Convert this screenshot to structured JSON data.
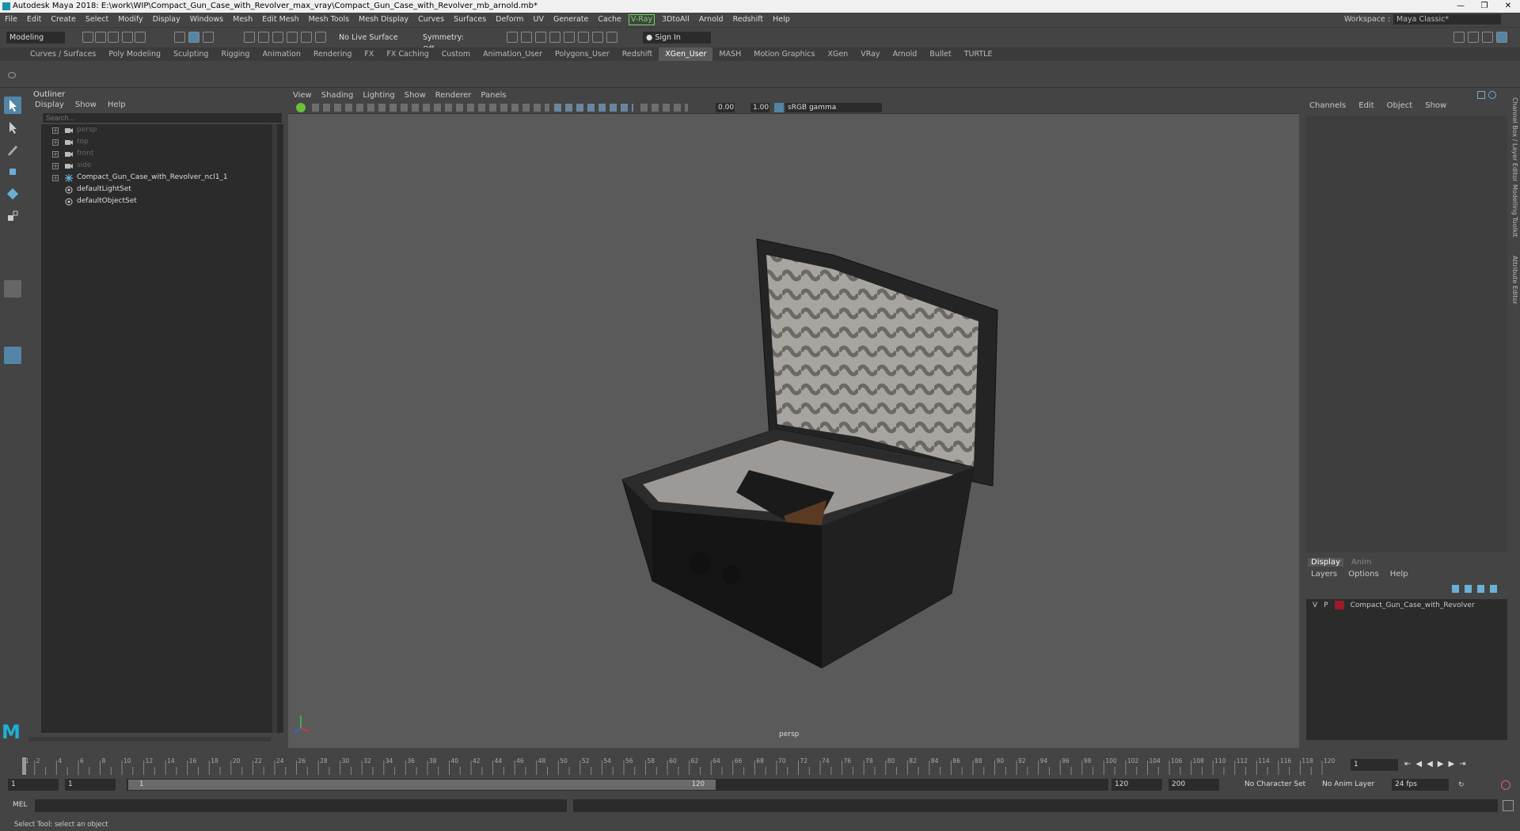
{
  "window": {
    "title": "Autodesk Maya 2018: E:\\work\\WIP\\Compact_Gun_Case_with_Revolver_max_vray\\Compact_Gun_Case_with_Revolver_mb_arnold.mb*",
    "controls": [
      "—",
      "❐",
      "✕"
    ]
  },
  "menubar": [
    "File",
    "Edit",
    "Create",
    "Select",
    "Modify",
    "Display",
    "Windows",
    "Mesh",
    "Edit Mesh",
    "Mesh Tools",
    "Mesh Display",
    "Curves",
    "Surfaces",
    "Deform",
    "UV",
    "Generate",
    "Cache"
  ],
  "menubar_vray": "V-Ray",
  "menubar_more": [
    "3DtoAll",
    "Arnold",
    "Redshift",
    "Help"
  ],
  "workspace": {
    "label": "Workspace :",
    "value": "Maya Classic*"
  },
  "statusline": {
    "mode": "Modeling",
    "live_surface": "No Live Surface",
    "symmetry": "Symmetry: Off",
    "sign_in": "Sign In"
  },
  "shelf_tabs": [
    "Curves / Surfaces",
    "Poly Modeling",
    "Sculpting",
    "Rigging",
    "Animation",
    "Rendering",
    "FX",
    "FX Caching",
    "Custom",
    "Animation_User",
    "Polygons_User",
    "Redshift",
    "XGen_User",
    "MASH",
    "Motion Graphics",
    "XGen",
    "VRay",
    "Arnold",
    "Bullet",
    "TURTLE"
  ],
  "active_shelf": "XGen_User",
  "outliner": {
    "title": "Outliner",
    "menu": [
      "Display",
      "Show",
      "Help"
    ],
    "search_placeholder": "Search...",
    "items": [
      {
        "label": "persp",
        "dim": true,
        "icon": "camera-icon"
      },
      {
        "label": "top",
        "dim": true,
        "icon": "camera-icon"
      },
      {
        "label": "front",
        "dim": true,
        "icon": "camera-icon"
      },
      {
        "label": "side",
        "dim": true,
        "icon": "camera-icon"
      },
      {
        "label": "Compact_Gun_Case_with_Revolver_ncl1_1",
        "dim": false,
        "icon": "group-icon"
      },
      {
        "label": "defaultLightSet",
        "dim": false,
        "icon": "set-icon"
      },
      {
        "label": "defaultObjectSet",
        "dim": false,
        "icon": "set-icon"
      }
    ]
  },
  "viewport": {
    "menu": [
      "View",
      "Shading",
      "Lighting",
      "Show",
      "Renderer",
      "Panels"
    ],
    "exposure": "0.00",
    "gamma": "1.00",
    "colorspace": "sRGB gamma",
    "camera_label": "persp"
  },
  "channelbox": {
    "menu": [
      "Channels",
      "Edit",
      "Object",
      "Show"
    ]
  },
  "layers": {
    "tabs": [
      "Display",
      "Anim"
    ],
    "menu": [
      "Layers",
      "Options",
      "Help"
    ],
    "row": {
      "v": "V",
      "p": "P",
      "name": "Compact_Gun_Case_with_Revolver",
      "color": "#9b1b2a"
    }
  },
  "side_tabs": [
    "Channel Box / Layer Editor",
    "Modelling Toolkit",
    "Attribute Editor"
  ],
  "timeline": {
    "ticks": [
      "1",
      "2",
      "4",
      "6",
      "8",
      "10",
      "12",
      "14",
      "16",
      "18",
      "20",
      "22",
      "24",
      "26",
      "28",
      "30",
      "32",
      "34",
      "36",
      "38",
      "40",
      "42",
      "44",
      "46",
      "48",
      "50",
      "52",
      "54",
      "56",
      "58",
      "60",
      "62",
      "64",
      "66",
      "68",
      "70",
      "72",
      "74",
      "76",
      "78",
      "80",
      "82",
      "84",
      "86",
      "88",
      "90",
      "92",
      "94",
      "96",
      "98",
      "100",
      "102",
      "104",
      "106",
      "108",
      "110",
      "112",
      "114",
      "116",
      "118",
      "120"
    ],
    "current": "1"
  },
  "range": {
    "start": "1",
    "start2": "1",
    "slider_start": "1",
    "slider_end": "120",
    "end": "120",
    "end2": "200",
    "char_set": "No Character Set",
    "anim_layer": "No Anim Layer",
    "fps": "24 fps"
  },
  "cmdline": {
    "label": "MEL"
  },
  "helpline": "Select Tool: select an object",
  "colors": {
    "accent": "#5285a6",
    "vray": "#6dde5a",
    "layer": "#9b1b2a"
  }
}
